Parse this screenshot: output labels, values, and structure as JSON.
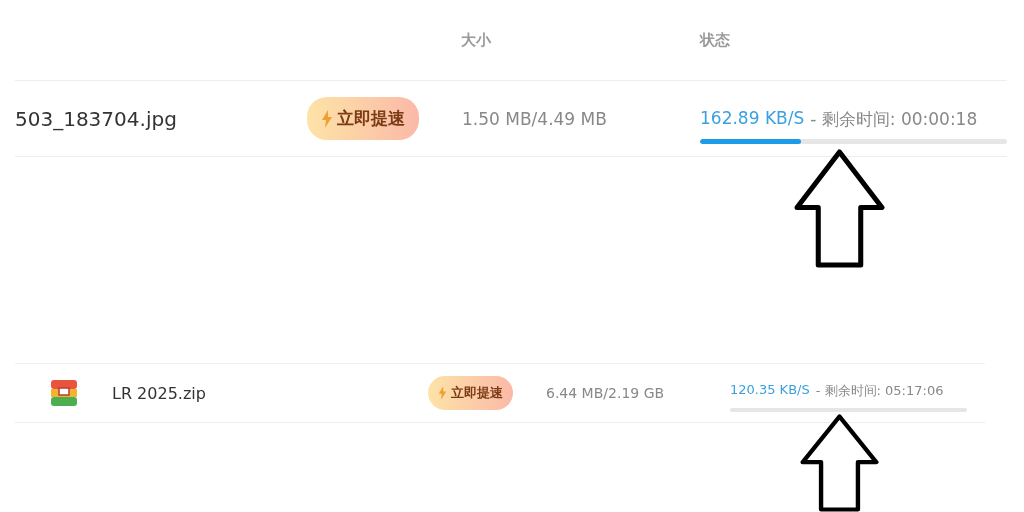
{
  "panels": [
    {
      "columns": [
        "大小",
        "状态"
      ],
      "rows": [
        {
          "name": "503_183704.jpg",
          "boost": "立即提速",
          "size": "1.50 MB/4.49 MB",
          "speed": "162.89 KB/S",
          "remaining": "- 剩余时间: 00:00:18",
          "level": 0.33
        }
      ]
    },
    {
      "rows": [
        {
          "kind": "archive",
          "name": "LR 2025.zip",
          "boost": "立即提速",
          "size": "6.44 MB/2.19 GB",
          "speed": "120.35 KB/S",
          "remaining": "- 剩余时间: 05:17:06"
        }
      ]
    }
  ]
}
